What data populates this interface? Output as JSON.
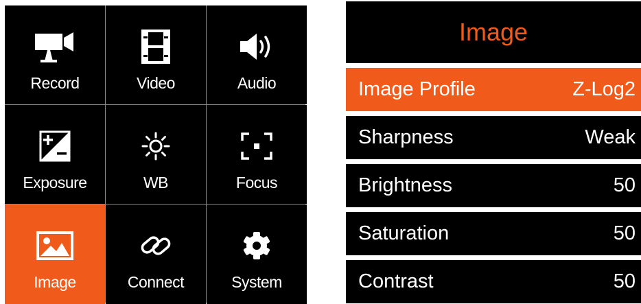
{
  "menu": {
    "items": [
      {
        "label": "Record",
        "icon": "video-camera-icon"
      },
      {
        "label": "Video",
        "icon": "film-icon"
      },
      {
        "label": "Audio",
        "icon": "speaker-icon"
      },
      {
        "label": "Exposure",
        "icon": "exposure-icon"
      },
      {
        "label": "WB",
        "icon": "sun-icon"
      },
      {
        "label": "Focus",
        "icon": "focus-frame-icon"
      },
      {
        "label": "Image",
        "icon": "picture-icon",
        "selected": true
      },
      {
        "label": "Connect",
        "icon": "link-icon"
      },
      {
        "label": "System",
        "icon": "gear-icon"
      }
    ]
  },
  "panel": {
    "title": "Image",
    "rows": [
      {
        "label": "Image Profile",
        "value": "Z-Log2",
        "selected": true
      },
      {
        "label": "Sharpness",
        "value": "Weak"
      },
      {
        "label": "Brightness",
        "value": "50"
      },
      {
        "label": "Saturation",
        "value": "50"
      },
      {
        "label": "Contrast",
        "value": "50"
      }
    ]
  },
  "colors": {
    "accent": "#f05a1a",
    "background": "#000000",
    "text": "#ffffff",
    "grid_line": "#8a8a8a"
  }
}
